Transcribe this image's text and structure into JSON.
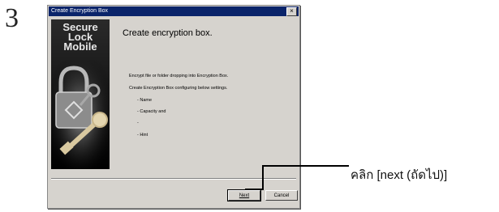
{
  "step_number": "3",
  "dialog": {
    "title": "Create Encryption Box",
    "close_glyph": "×",
    "banner_title": [
      "Secure",
      "Lock",
      "Mobile"
    ],
    "heading": "Create encryption box.",
    "description": [
      "Encrypt file or folder dropping into Encryption Box.",
      "Create Encryption Box configuring below settings.",
      "- Name",
      "- Capacity and",
      "-",
      "- Hint"
    ],
    "buttons": {
      "next": "Next",
      "cancel": "Cancel"
    }
  },
  "callout": {
    "label": "คลิก [next (ถัดไป)]"
  },
  "colors": {
    "titlebar": "#0a246a",
    "dialog_bg": "#d6d3ce"
  },
  "icons": [
    "close-icon",
    "padlock-icon",
    "key-icon"
  ]
}
